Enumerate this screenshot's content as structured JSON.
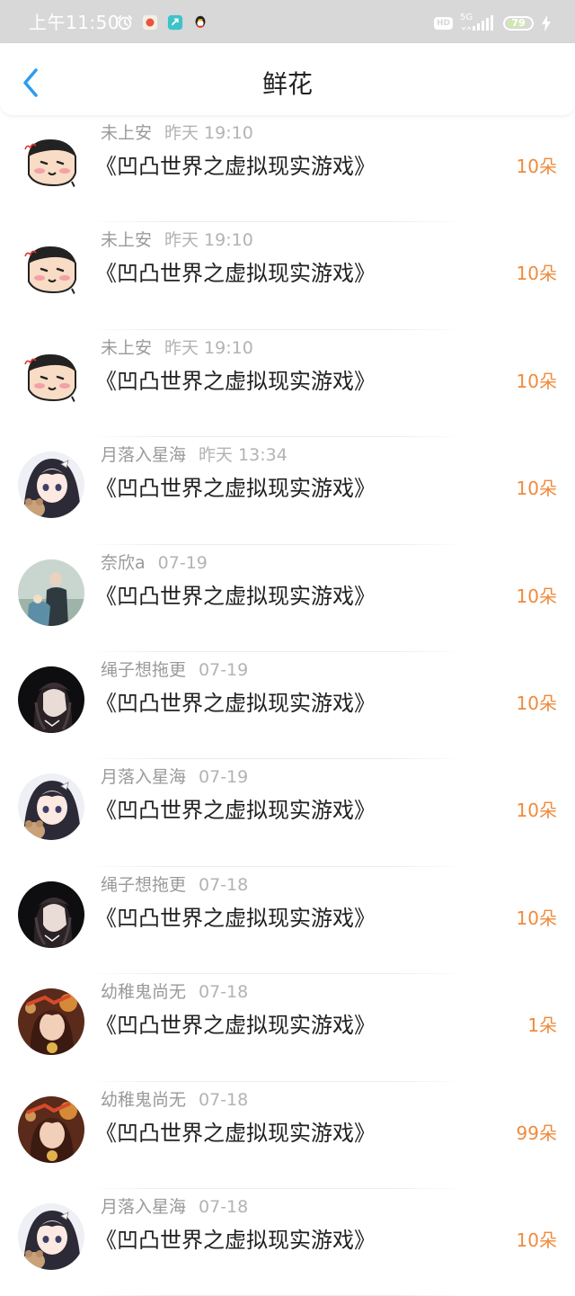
{
  "status_bar": {
    "time": "上午11:50",
    "icons": [
      "alarm-icon",
      "notification-app-icon",
      "notification-app-icon-2",
      "qq-penguin-icon"
    ],
    "hd_badge": "HD",
    "network": "5G",
    "battery": "79"
  },
  "header": {
    "title": "鲜花",
    "back_icon": "chevron-left-icon"
  },
  "colors": {
    "accent_blue": "#2b9cf0",
    "count_orange": "#f08a3c",
    "status_bar_bg": "#d8d8d8"
  },
  "items": [
    {
      "user": "未上安",
      "time": "昨天 19:10",
      "book": "《凹凸世界之虚拟现实游戏》",
      "count": "10朵",
      "avatar": "cartoon-avatar"
    },
    {
      "user": "未上安",
      "time": "昨天 19:10",
      "book": "《凹凸世界之虚拟现实游戏》",
      "count": "10朵",
      "avatar": "cartoon-avatar"
    },
    {
      "user": "未上安",
      "time": "昨天 19:10",
      "book": "《凹凸世界之虚拟现实游戏》",
      "count": "10朵",
      "avatar": "cartoon-avatar"
    },
    {
      "user": "月落入星海",
      "time": "昨天 13:34",
      "book": "《凹凸世界之虚拟现实游戏》",
      "count": "10朵",
      "avatar": "anime-girl-avatar"
    },
    {
      "user": "奈欣a",
      "time": "07-19",
      "book": "《凹凸世界之虚拟现实游戏》",
      "count": "10朵",
      "avatar": "photo-avatar"
    },
    {
      "user": "绳子想拖更",
      "time": "07-19",
      "book": "《凹凸世界之虚拟现实游戏》",
      "count": "10朵",
      "avatar": "dark-anime-avatar"
    },
    {
      "user": "月落入星海",
      "time": "07-19",
      "book": "《凹凸世界之虚拟现实游戏》",
      "count": "10朵",
      "avatar": "anime-girl-avatar"
    },
    {
      "user": "绳子想拖更",
      "time": "07-18",
      "book": "《凹凸世界之虚拟现实游戏》",
      "count": "10朵",
      "avatar": "dark-anime-avatar"
    },
    {
      "user": "幼稚鬼尚无",
      "time": "07-18",
      "book": "《凹凸世界之虚拟现实游戏》",
      "count": "1朵",
      "avatar": "warm-anime-avatar"
    },
    {
      "user": "幼稚鬼尚无",
      "time": "07-18",
      "book": "《凹凸世界之虚拟现实游戏》",
      "count": "99朵",
      "avatar": "warm-anime-avatar"
    },
    {
      "user": "月落入星海",
      "time": "07-18",
      "book": "《凹凸世界之虚拟现实游戏》",
      "count": "10朵",
      "avatar": "anime-girl-avatar"
    }
  ]
}
